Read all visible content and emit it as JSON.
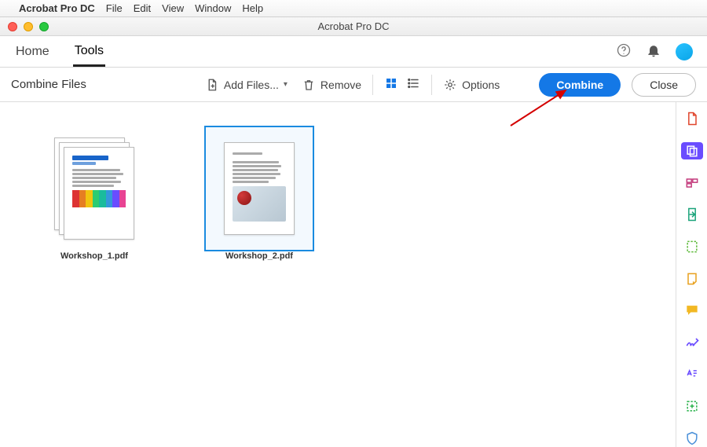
{
  "menubar": {
    "app": "Acrobat Pro DC",
    "items": [
      "File",
      "Edit",
      "View",
      "Window",
      "Help"
    ]
  },
  "window": {
    "title": "Acrobat Pro DC"
  },
  "tabs": {
    "home": "Home",
    "tools": "Tools",
    "active": "tools"
  },
  "toolbar": {
    "title": "Combine Files",
    "add_files": "Add Files...",
    "remove": "Remove",
    "options": "Options",
    "combine": "Combine",
    "close": "Close"
  },
  "files": [
    {
      "name": "Workshop_1.pdf",
      "selected": false,
      "stacked": true
    },
    {
      "name": "Workshop_2.pdf",
      "selected": true,
      "stacked": false
    }
  ],
  "rail_icons": [
    "create-pdf-icon",
    "combine-icon",
    "organize-icon",
    "export-icon",
    "edit-icon",
    "comment-icon",
    "sign-icon",
    "redact-icon",
    "compare-icon",
    "protect-icon"
  ]
}
